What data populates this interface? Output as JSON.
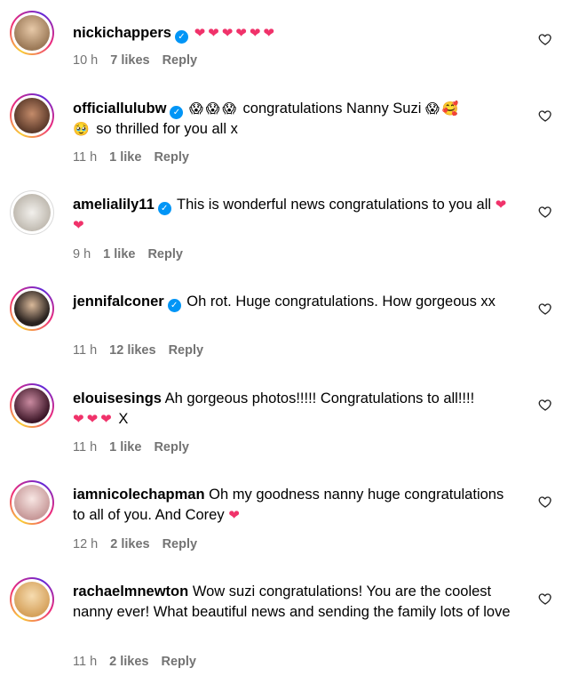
{
  "comments": [
    {
      "username": "nickichappers",
      "verified": true,
      "text": "",
      "emojis": "❤❤❤❤❤❤",
      "time": "10 h",
      "likes": "7 likes",
      "reply": "Reply",
      "avatar_color": "#c9a37a"
    },
    {
      "username": "officiallulubw",
      "verified": true,
      "text_parts": [
        "😱😱😱",
        "congratulations Nanny Suzi",
        "😱🥰",
        "🥹",
        "so thrilled for you all x"
      ],
      "time": "11 h",
      "likes": "1 like",
      "reply": "Reply",
      "avatar_color": "#8a5a45"
    },
    {
      "username": "amelialily11",
      "verified": true,
      "text": "This is wonderful news congratulations to you all",
      "emojis": "❤❤",
      "time": "9 h",
      "likes": "1 like",
      "reply": "Reply",
      "avatar_color": "#d7d4cf"
    },
    {
      "username": "jennifalconer",
      "verified": true,
      "text": "Oh rot. Huge congratulations. How gorgeous xx",
      "time": "11 h",
      "likes": "12 likes",
      "reply": "Reply",
      "avatar_color": "#3a2f2a"
    },
    {
      "username": "elouisesings",
      "verified": false,
      "text": "Ah gorgeous photos!!!!! Congratulations to all!!!!",
      "emojis": "❤❤❤",
      "tail": "X",
      "time": "11 h",
      "likes": "1 like",
      "reply": "Reply",
      "avatar_color": "#5b2a3d"
    },
    {
      "username": "iamnicolechapman",
      "verified": false,
      "text": "Oh my goodness nanny huge congratulations to all of you. And Corey",
      "emojis": "❤",
      "time": "12 h",
      "likes": "2 likes",
      "reply": "Reply",
      "avatar_color": "#e7c7c4"
    },
    {
      "username": "rachaelmnewton",
      "verified": false,
      "text": "Wow suzi congratulations! You are the coolest nanny ever! What beautiful news and sending the family lots of love",
      "time": "11 h",
      "likes": "2 likes",
      "reply": "Reply",
      "avatar_color": "#e3c089"
    }
  ],
  "colors": {
    "accent_heart": "#f0326a",
    "verified_blue": "#0095f6",
    "meta_grey": "#737373"
  },
  "icons": {
    "like": "heart-outline-icon",
    "verified": "verified-badge-icon"
  }
}
